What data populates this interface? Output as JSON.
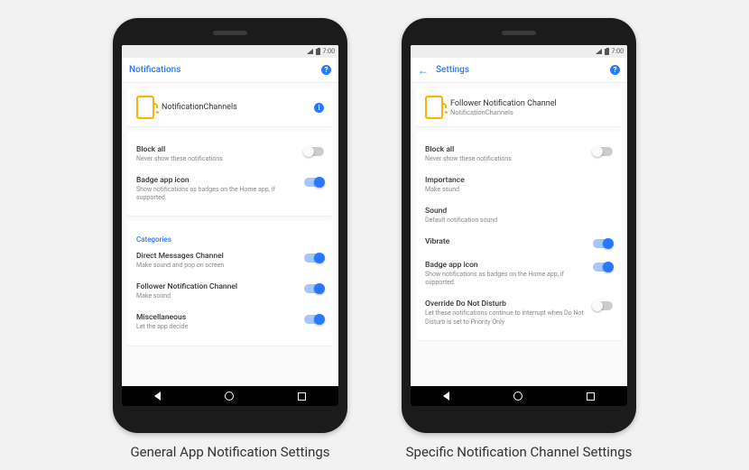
{
  "status_time": "7:00",
  "captions": {
    "left": "General App Notification Settings",
    "right": "Specific Notification Channel Settings"
  },
  "left": {
    "title": "Notifications",
    "app_name": "NotificationChannels",
    "block_all": {
      "title": "Block all",
      "sub": "Never show these notifications"
    },
    "badge": {
      "title": "Badge app icon",
      "sub": "Show notifications as badges on the Home app, if supported."
    },
    "categories_label": "Categories",
    "cat_direct": {
      "title": "Direct Messages Channel",
      "sub": "Make sound and pop on screen"
    },
    "cat_follower": {
      "title": "Follower Notification Channel",
      "sub": "Make sound"
    },
    "cat_misc": {
      "title": "Miscellaneous",
      "sub": "Let the app decide"
    }
  },
  "right": {
    "title": "Settings",
    "channel_name": "Follower Notification Channel",
    "app_name": "NotificationChannels",
    "block_all": {
      "title": "Block all",
      "sub": "Never show these notifications"
    },
    "importance": {
      "title": "Importance",
      "sub": "Make sound"
    },
    "sound": {
      "title": "Sound",
      "sub": "Default notification sound"
    },
    "vibrate": {
      "title": "Vibrate"
    },
    "badge": {
      "title": "Badge app icon",
      "sub": "Show notifications as badges on the Home app, if supported."
    },
    "dnd": {
      "title": "Override Do Not Disturb",
      "sub": "Let these notifications continue to interrupt when Do Not Disturb is set to Priority Only"
    }
  }
}
